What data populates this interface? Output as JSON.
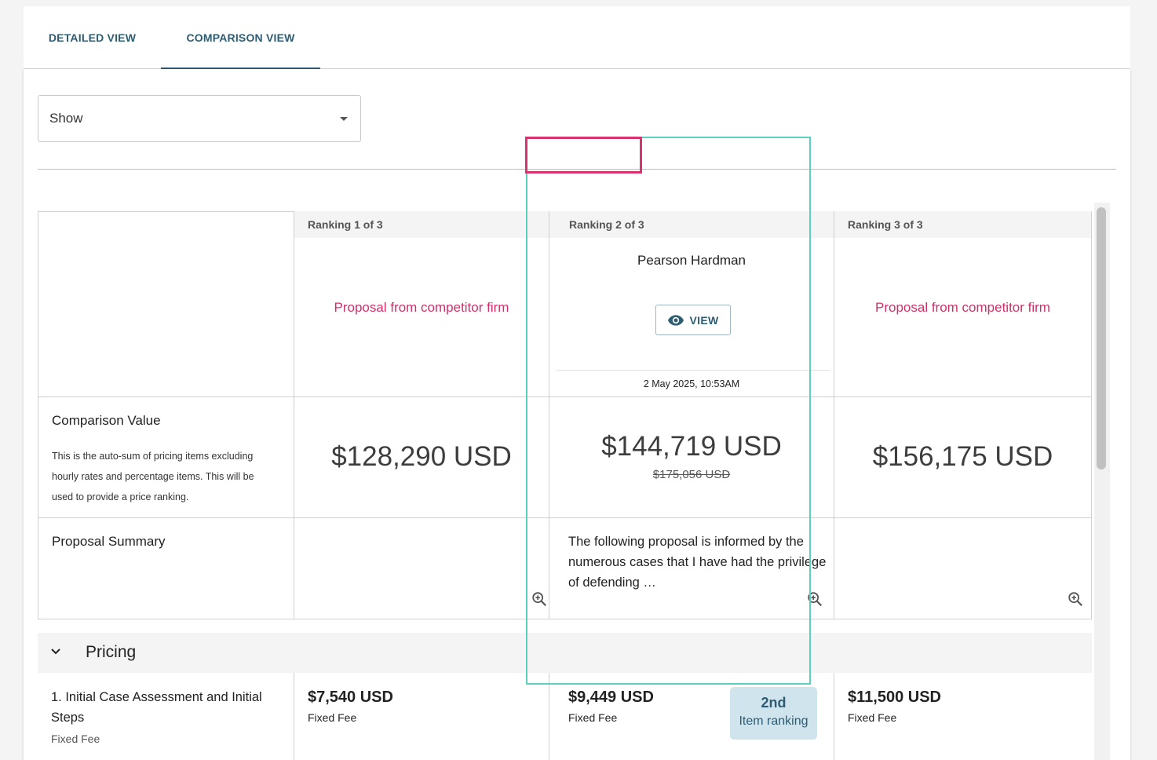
{
  "tabs": [
    {
      "label": "DETAILED VIEW"
    },
    {
      "label": "COMPARISON VIEW"
    }
  ],
  "filter": {
    "value": "Show"
  },
  "columns": [
    {
      "ranking": "Ranking 1 of 3",
      "competitor_label": "Proposal from competitor firm",
      "comparison_value": "$128,290 USD"
    },
    {
      "ranking": "Ranking 2 of 3",
      "firm": "Pearson Hardman",
      "view_label": "VIEW",
      "date": "2 May 2025, 10:53AM",
      "comparison_value": "$144,719 USD",
      "original_value": "$175,056 USD",
      "summary": "The following proposal is informed by the numerous cases that I have had the privilege of defending …"
    },
    {
      "ranking": "Ranking 3 of 3",
      "competitor_label": "Proposal from competitor firm",
      "comparison_value": "$156,175 USD"
    }
  ],
  "rows": {
    "comparison": {
      "title": "Comparison Value",
      "description": "This is the auto-sum of pricing items excluding hourly rates and percentage items. This will be used to provide a price ranking."
    },
    "summary": {
      "title": "Proposal Summary"
    }
  },
  "pricing": {
    "section_title": "Pricing",
    "items": [
      {
        "name": "1. Initial Case Assessment and Initial Steps",
        "type": "Fixed Fee",
        "values": [
          {
            "price": "$7,540 USD",
            "fee": "Fixed Fee"
          },
          {
            "price": "$9,449 USD",
            "fee": "Fixed Fee",
            "rank": "2nd",
            "rank_label": "Item ranking"
          },
          {
            "price": "$11,500 USD",
            "fee": "Fixed Fee"
          }
        ]
      }
    ]
  },
  "colors": {
    "accent": "#2e5c73",
    "competitor": "#d0306a",
    "highlight_column": "#5ccfc0",
    "highlight_header": "#d8336f",
    "badge_bg": "#cfe4ec"
  }
}
